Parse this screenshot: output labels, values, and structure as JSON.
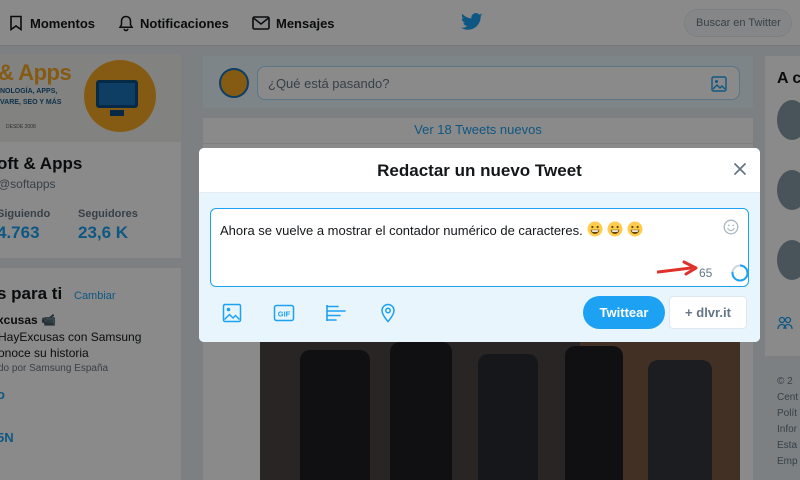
{
  "nav": {
    "moments_label": "Momentos",
    "notifications_label": "Notificaciones",
    "messages_label": "Mensajes",
    "search_placeholder": "Buscar en Twitter"
  },
  "profile": {
    "banner_word": "& Apps",
    "banner_line1": "NOLOGÍA, APPS,",
    "banner_line2": "VARE, SEO Y MÁS",
    "banner_line3": "DESDE 2008",
    "name": "oft & Apps",
    "handle": "@softapps",
    "following_label": "Siguiendo",
    "following_value": "4.763",
    "followers_label": "Seguidores",
    "followers_value": "23,6 K"
  },
  "trends": {
    "title": "s para ti",
    "change_label": "Cambiar",
    "tag": "xcusas 📹",
    "description": "HayExcusas con Samsung\nonoce su historia",
    "promoted": "do por Samsung España",
    "extra1": "o",
    "extra2": "5N"
  },
  "composer": {
    "placeholder": "¿Qué está pasando?",
    "new_tweets": "Ver 18 Tweets nuevos"
  },
  "right": {
    "title": "A c",
    "footer": [
      "© 2",
      "Cent",
      "Polít",
      "Infor",
      "Esta",
      "Emp"
    ]
  },
  "modal": {
    "title": "Redactar un nuevo Tweet",
    "tweet_text": "Ahora se vuelve a mostrar el contador numérico de caracteres.",
    "emoji_count": 3,
    "counter": "65",
    "progress": 0.77,
    "tweet_button": "Twittear",
    "dlvr_button": "+ dlvr.it"
  },
  "colors": {
    "accent": "#1da1f2",
    "annotation_arrow": "#e0302a",
    "brand_orange": "#f5a623"
  },
  "icons": [
    "moments-icon",
    "bell-icon",
    "mail-icon",
    "twitter-bird-icon",
    "photo-icon",
    "gif-icon",
    "poll-icon",
    "location-pin-icon",
    "close-icon",
    "emoji-icon",
    "people-icon"
  ]
}
